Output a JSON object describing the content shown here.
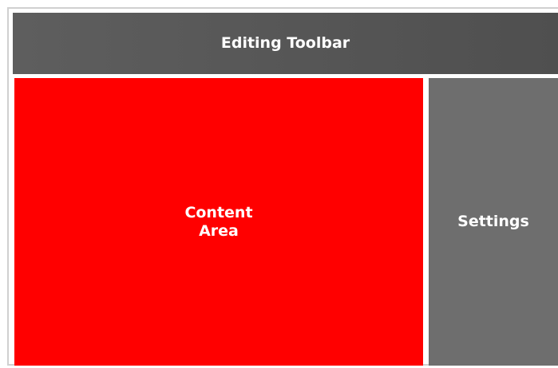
{
  "layout_regions": [
    {
      "id": "toolbar",
      "label": "Editing Toolbar",
      "color": "#555555"
    },
    {
      "id": "content",
      "label": "Content\nArea",
      "color": "#ff0000"
    },
    {
      "id": "settings",
      "label": "Settings",
      "color": "#6e6e6e"
    }
  ]
}
